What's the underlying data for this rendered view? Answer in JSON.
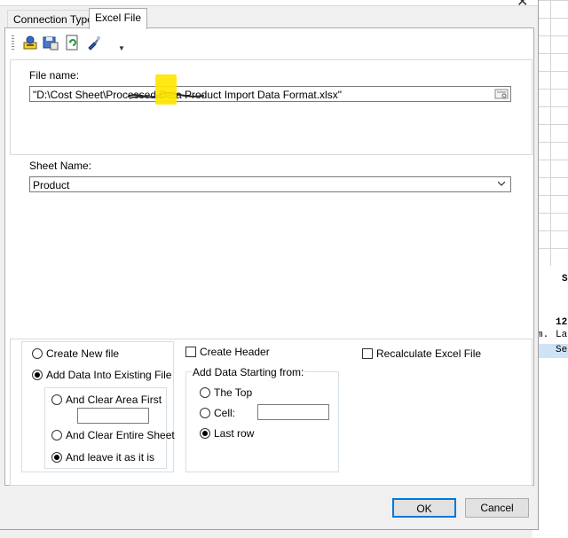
{
  "tabs": [
    {
      "label": "Connection Type"
    },
    {
      "label": "Excel File"
    }
  ],
  "toolbar": {
    "icons": [
      "connect-icon",
      "save-settings-icon",
      "refresh-icon",
      "brush-icon",
      "dropdown-arrow-icon"
    ]
  },
  "file": {
    "label": "File name:",
    "value": "\"D:\\Cost Sheet\\Processed Data Product Import Data Format.xlsx\""
  },
  "sheet": {
    "label": "Sheet Name:",
    "value": "Product"
  },
  "options": {
    "create_new": "Create New file",
    "add_existing": "Add Data Into Existing File",
    "clear_area": "And Clear Area First",
    "clear_area_value": "",
    "clear_sheet": "And Clear Entire Sheet",
    "leave": "And leave it as it is",
    "create_header": "Create Header",
    "start_group": "Add Data Starting from:",
    "the_top": "The Top",
    "cell": "Cell:",
    "cell_value": "",
    "last_row": "Last row",
    "recalculate": "Recalculate Excel File"
  },
  "buttons": {
    "ok": "OK",
    "cancel": "Cancel"
  },
  "background": {
    "cells": [
      "12",
      "m.",
      "La",
      "Se",
      "S"
    ]
  }
}
